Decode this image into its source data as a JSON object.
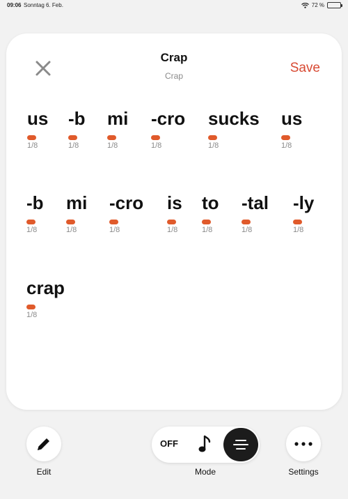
{
  "status_bar": {
    "time": "09:06",
    "date": "Sonntag 6. Feb.",
    "battery": "72 %",
    "battery_level": 0.72
  },
  "header": {
    "close_icon": "close-icon",
    "title": "Crap",
    "subtitle": "Crap",
    "save_label": "Save"
  },
  "colors": {
    "accent": "#d84a33",
    "note_pill": "#e05a2b",
    "mode_active_bg": "#1c1c1c"
  },
  "lyrics": {
    "lines": [
      {
        "syllables": [
          {
            "text": "us",
            "duration": "1/8"
          },
          {
            "text": "-b",
            "duration": "1/8"
          },
          {
            "text": "mi",
            "duration": "1/8"
          },
          {
            "text": "-cro",
            "duration": "1/8"
          },
          {
            "text": "sucks",
            "duration": "1/8"
          },
          {
            "text": "us",
            "duration": "1/8"
          }
        ]
      },
      {
        "syllables": [
          {
            "text": "-b",
            "duration": "1/8"
          },
          {
            "text": "mi",
            "duration": "1/8"
          },
          {
            "text": "-cro",
            "duration": "1/8"
          },
          {
            "text": "is",
            "duration": "1/8"
          },
          {
            "text": "to",
            "duration": "1/8"
          },
          {
            "text": "-tal",
            "duration": "1/8"
          },
          {
            "text": "-ly",
            "duration": "1/8"
          }
        ]
      },
      {
        "syllables": [
          {
            "text": "crap",
            "duration": "1/8"
          }
        ]
      }
    ]
  },
  "toolbar": {
    "edit_label": "Edit",
    "edit_icon": "pencil-icon",
    "mode_label": "Mode",
    "mode_off_label": "OFF",
    "mode_note_icon": "music-note-icon",
    "mode_lyrics_icon": "lyrics-lines-icon",
    "mode_selected": "lyrics",
    "settings_label": "Settings",
    "settings_icon": "more-dots-icon"
  }
}
